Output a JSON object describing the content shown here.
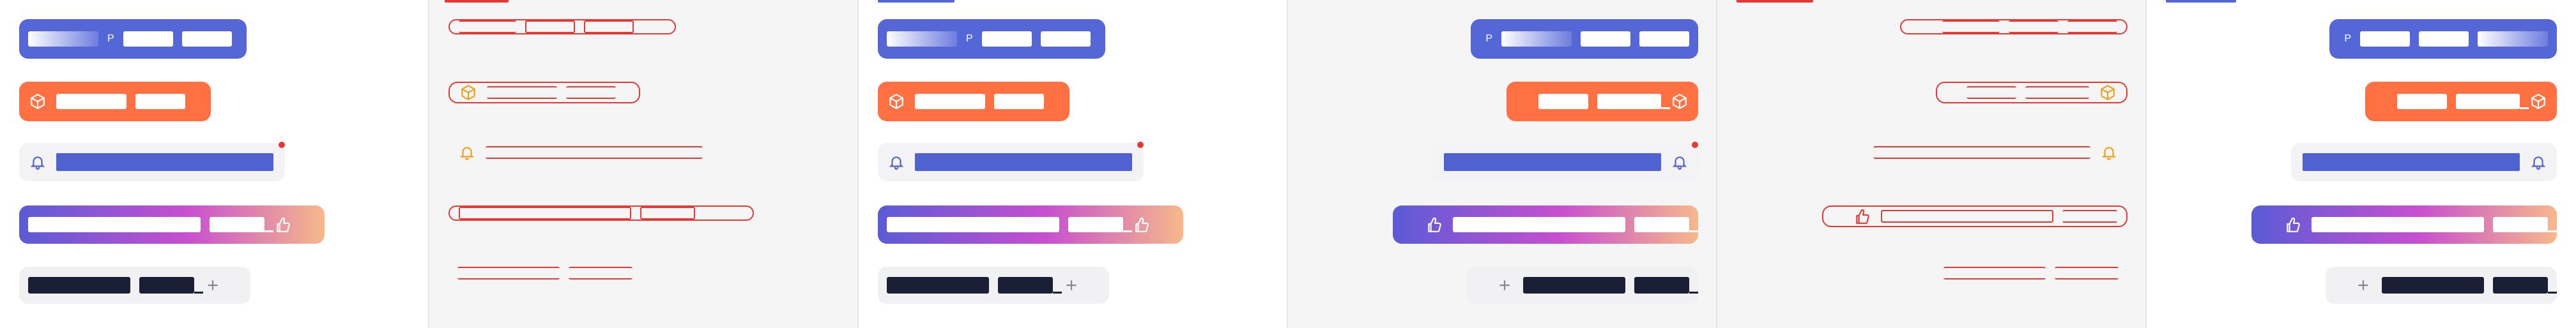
{
  "mini_label": "P",
  "colors": {
    "blue_pill": "#5566d6",
    "orange_pill": "#ff7043",
    "gradient_start": "#5b5bd6",
    "gradient_mid": "#c84fd0",
    "gradient_end": "#f6b98a",
    "navy_text": "#1b1f36",
    "band_blue": "#4f62cf",
    "notification_dot": "#e53935",
    "glitch_red": "#e53935"
  },
  "icons": {
    "cube": "cube-icon",
    "bell": "bell-icon",
    "thumbs_up": "thumbs-up-icon",
    "plus": "plus-icon"
  },
  "plus_glyph": "+"
}
